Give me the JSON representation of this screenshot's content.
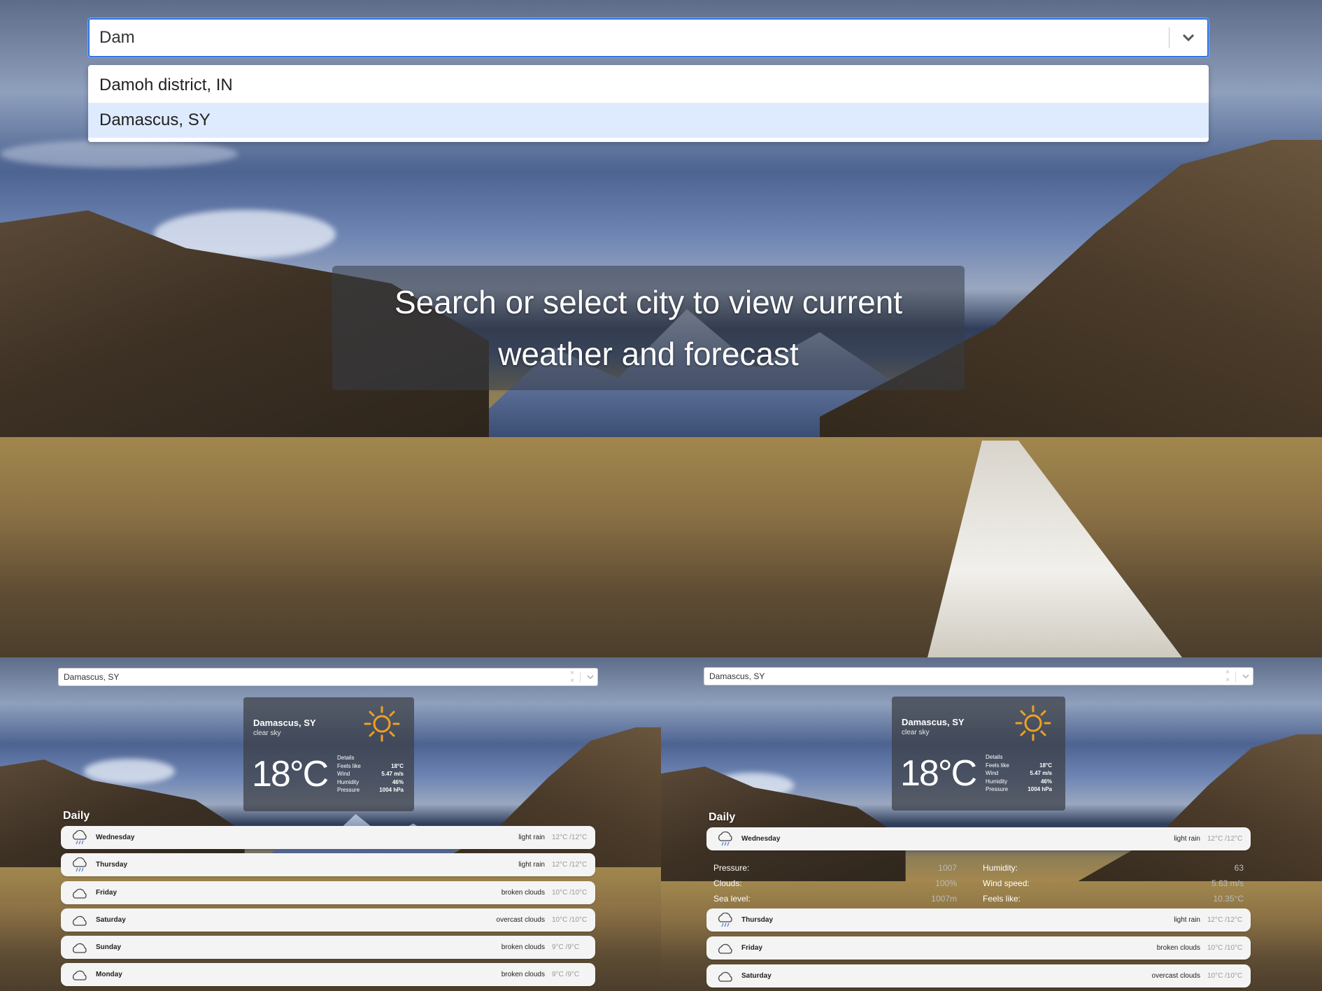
{
  "top": {
    "search": {
      "value": "Dam"
    },
    "options": [
      "Damoh district, IN",
      "Damascus, SY"
    ],
    "banner": [
      "Search or select city to view current",
      "weather and forecast"
    ]
  },
  "panel_left": {
    "search_value": "Damascus, SY",
    "clear_glyph": "× ×",
    "current": {
      "city": "Damascus, SY",
      "desc": "clear sky",
      "temp": "18°C",
      "details_title": "Details",
      "details": [
        {
          "k": "Feels like",
          "v": "18°C"
        },
        {
          "k": "Wind",
          "v": "5.47 m/s"
        },
        {
          "k": "Humidity",
          "v": "46%"
        },
        {
          "k": "Pressure",
          "v": "1004 hPa"
        }
      ]
    },
    "daily_title": "Daily",
    "daily": [
      {
        "day": "Wednesday",
        "cond": "light rain",
        "temp": "12°C /12°C",
        "icon": "rain-cloud-icon"
      },
      {
        "day": "Thursday",
        "cond": "light rain",
        "temp": "12°C /12°C",
        "icon": "rain-cloud-icon"
      },
      {
        "day": "Friday",
        "cond": "broken clouds",
        "temp": "10°C /10°C",
        "icon": "cloud-icon"
      },
      {
        "day": "Saturday",
        "cond": "overcast clouds",
        "temp": "10°C /10°C",
        "icon": "cloud-icon"
      },
      {
        "day": "Sunday",
        "cond": "broken clouds",
        "temp": "9°C /9°C",
        "icon": "cloud-icon"
      },
      {
        "day": "Monday",
        "cond": "broken clouds",
        "temp": "9°C /9°C",
        "icon": "cloud-icon"
      }
    ]
  },
  "panel_right": {
    "search_value": "Damascus, SY",
    "clear_glyph": "× ×",
    "current": {
      "city": "Damascus, SY",
      "desc": "clear sky",
      "temp": "18°C",
      "details_title": "Details",
      "details": [
        {
          "k": "Feels like",
          "v": "18°C"
        },
        {
          "k": "Wind",
          "v": "5.47 m/s"
        },
        {
          "k": "Humidity",
          "v": "46%"
        },
        {
          "k": "Pressure",
          "v": "1004 hPa"
        }
      ]
    },
    "daily_title": "Daily",
    "daily": [
      {
        "day": "Wednesday",
        "cond": "light rain",
        "temp": "12°C /12°C",
        "icon": "rain-cloud-icon"
      },
      {
        "day": "Thursday",
        "cond": "light rain",
        "temp": "12°C /12°C",
        "icon": "rain-cloud-icon"
      },
      {
        "day": "Friday",
        "cond": "broken clouds",
        "temp": "10°C /10°C",
        "icon": "cloud-icon"
      },
      {
        "day": "Saturday",
        "cond": "overcast clouds",
        "temp": "10°C /10°C",
        "icon": "cloud-icon"
      }
    ],
    "expanded": {
      "left": [
        {
          "k": "Pressure:",
          "v": "1007"
        },
        {
          "k": "Clouds:",
          "v": "100%"
        },
        {
          "k": "Sea level:",
          "v": "1007m"
        }
      ],
      "right": [
        {
          "k": "Humidity:",
          "v": "63"
        },
        {
          "k": "Wind speed:",
          "v": "5.63 m/s"
        },
        {
          "k": "Feels like:",
          "v": "10.35°C"
        }
      ]
    }
  },
  "colors": {
    "accent": "#2f73e0",
    "selected_option": "#deebff",
    "sun": "#f0a020"
  }
}
